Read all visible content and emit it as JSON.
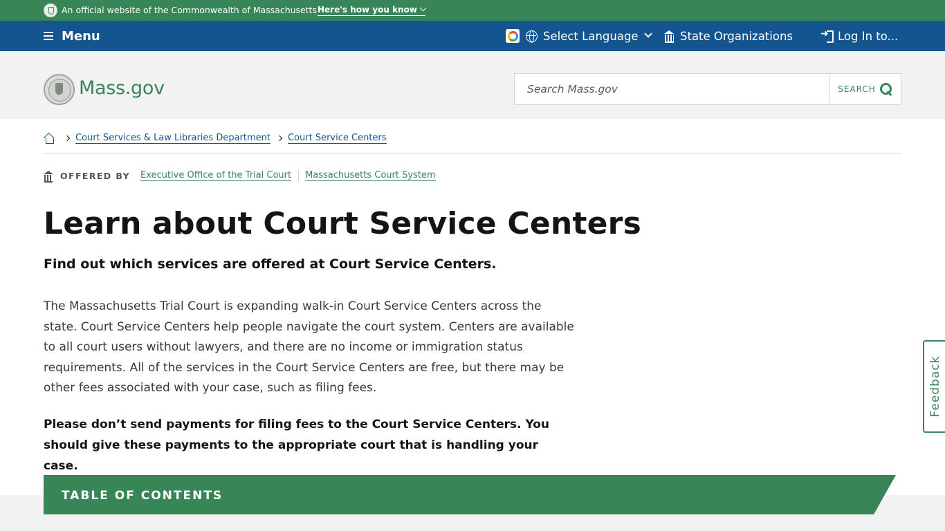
{
  "official_banner": {
    "text": "An official website of the Commonwealth of Massachusetts",
    "link": "Here's how you know"
  },
  "navbar": {
    "menu": "Menu",
    "language": "Select Language",
    "orgs": "State Organizations",
    "login": "Log In to..."
  },
  "header": {
    "logo": "Mass.gov",
    "search_placeholder": "Search Mass.gov",
    "search_button": "SEARCH"
  },
  "breadcrumb": [
    "Court Services & Law Libraries Department",
    "Court Service Centers"
  ],
  "offered_by": {
    "label": "OFFERED BY",
    "orgs": [
      "Executive Office of the Trial Court",
      "Massachusetts Court System"
    ]
  },
  "main": {
    "title": "Learn about Court Service Centers",
    "subtitle": "Find out which services are offered at Court Service Centers.",
    "body": "The Massachusetts Trial Court is expanding walk-in Court Service Centers across the state. Court Service Centers help people navigate the court system. Centers are available to all court users without lawyers, and there are no income or immigration status requirements. All of the services in the Court Service Centers are free, but there may be other fees associated with your case, such as filing fees.",
    "notice": "Please don’t send payments for filing fees to the Court Service Centers. You should give these payments to the appropriate court that is handling your case."
  },
  "toc": {
    "label": "TABLE OF CONTENTS"
  },
  "feedback": {
    "label": "Feedback"
  },
  "colors": {
    "green": "#388557",
    "blue": "#14558f",
    "header_bg": "#f2f2f2"
  },
  "icons": [
    "seal-icon",
    "chevron-down-icon",
    "hamburger-icon",
    "google-translate-icon",
    "globe-icon",
    "building-icon",
    "login-icon",
    "search-icon",
    "home-icon",
    "chevron-right-icon"
  ]
}
